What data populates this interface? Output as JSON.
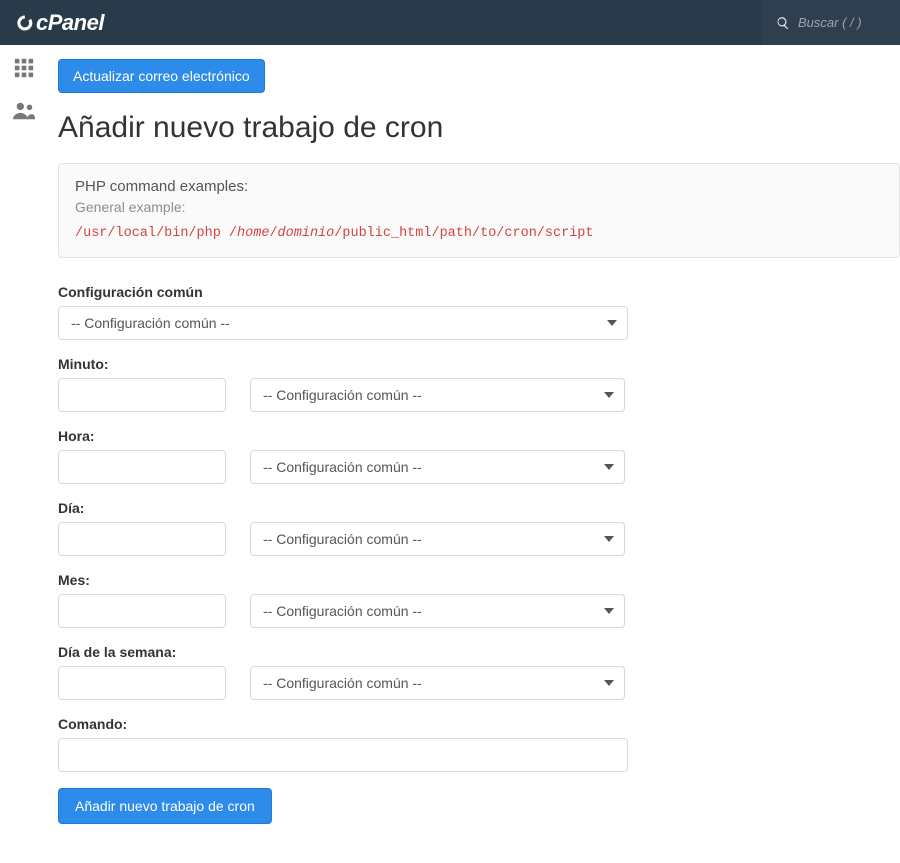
{
  "brand": "cPanel",
  "search": {
    "placeholder": "Buscar ( / )"
  },
  "buttons": {
    "update_email": "Actualizar correo electrónico",
    "add_cron": "Añadir nuevo trabajo de cron"
  },
  "page_title": "Añadir nuevo trabajo de cron",
  "callout": {
    "heading": "PHP command examples:",
    "sub": "General example:",
    "code_prefix": "/usr/local/bin/php /",
    "code_em1": "home",
    "code_sep1": "/",
    "code_em2": "dominio",
    "code_suffix": "/public_html/path/to/cron/script"
  },
  "labels": {
    "common": "Configuración común",
    "minute": "Minuto:",
    "hour": "Hora:",
    "day": "Día:",
    "month": "Mes:",
    "weekday": "Día de la semana:",
    "command": "Comando:"
  },
  "select_common": "-- Configuración común --"
}
